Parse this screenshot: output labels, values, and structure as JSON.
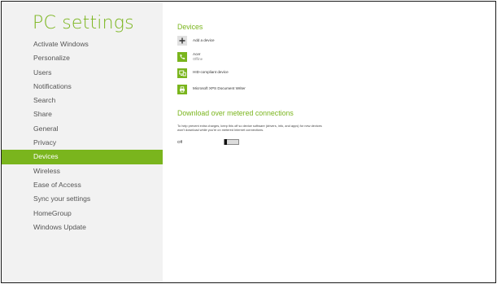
{
  "sidebar": {
    "title": "PC settings",
    "items": [
      {
        "label": "Activate Windows"
      },
      {
        "label": "Personalize"
      },
      {
        "label": "Users"
      },
      {
        "label": "Notifications"
      },
      {
        "label": "Search"
      },
      {
        "label": "Share"
      },
      {
        "label": "General"
      },
      {
        "label": "Privacy"
      },
      {
        "label": "Devices",
        "active": true
      },
      {
        "label": "Wireless"
      },
      {
        "label": "Ease of Access"
      },
      {
        "label": "Sync your settings"
      },
      {
        "label": "HomeGroup"
      },
      {
        "label": "Windows Update"
      }
    ]
  },
  "devices": {
    "title": "Devices",
    "add_label": "Add a device",
    "list": [
      {
        "name": "Acer",
        "status": "Offline",
        "icon": "phone-icon"
      },
      {
        "name": "HID-compliant device",
        "status": "",
        "icon": "hid-device-icon"
      },
      {
        "name": "Microsoft XPS Document Writer",
        "status": "",
        "icon": "printer-icon"
      }
    ]
  },
  "metered": {
    "title": "Download over metered connections",
    "description": "To help prevent extra charges, keep this off so device software (drivers, info, and apps) for new devices won't download while you're on metered Internet connections.",
    "toggle_state": "Off"
  },
  "colors": {
    "accent": "#7ab51d",
    "sidebar_bg": "#f2f2f2",
    "add_icon_bg": "#e0e0e0"
  }
}
